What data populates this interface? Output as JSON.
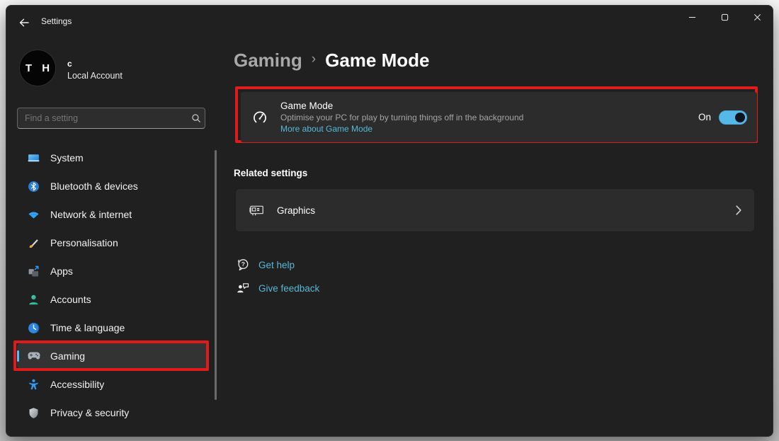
{
  "window": {
    "title": "Settings"
  },
  "account": {
    "initials": "T H",
    "name": "c",
    "type": "Local Account"
  },
  "search": {
    "placeholder": "Find a setting"
  },
  "sidebar": {
    "items": [
      {
        "label": "System",
        "icon": "system-icon"
      },
      {
        "label": "Bluetooth & devices",
        "icon": "bluetooth-icon"
      },
      {
        "label": "Network & internet",
        "icon": "network-icon"
      },
      {
        "label": "Personalisation",
        "icon": "personalisation-icon"
      },
      {
        "label": "Apps",
        "icon": "apps-icon"
      },
      {
        "label": "Accounts",
        "icon": "accounts-icon"
      },
      {
        "label": "Time & language",
        "icon": "time-language-icon"
      },
      {
        "label": "Gaming",
        "icon": "gamepad-icon"
      },
      {
        "label": "Accessibility",
        "icon": "accessibility-icon"
      },
      {
        "label": "Privacy & security",
        "icon": "shield-icon"
      }
    ],
    "selected": "Gaming"
  },
  "breadcrumb": {
    "parent": "Gaming",
    "separator": "›",
    "current": "Game Mode"
  },
  "game_mode": {
    "title": "Game Mode",
    "description": "Optimise your PC for play by turning things off in the background",
    "link": "More about Game Mode",
    "toggle_label": "On",
    "toggle_state": "on",
    "icon": "speedometer-icon"
  },
  "related": {
    "header": "Related settings",
    "items": [
      {
        "label": "Graphics",
        "icon": "gpu-icon"
      }
    ]
  },
  "footer_links": [
    {
      "label": "Get help",
      "icon": "help-bubble-icon"
    },
    {
      "label": "Give feedback",
      "icon": "feedback-icon"
    }
  ],
  "annotations": {
    "color": "#e01b1b",
    "targets": [
      "gaming-sidebar-item",
      "game-mode-card"
    ]
  },
  "colors": {
    "accent": "#4cc2ff",
    "link": "#58b8d6",
    "toggle_track": "#56b7e9",
    "window_bg": "#202020",
    "card_bg": "#2c2c2c",
    "annotation_red": "#e01b1b"
  }
}
